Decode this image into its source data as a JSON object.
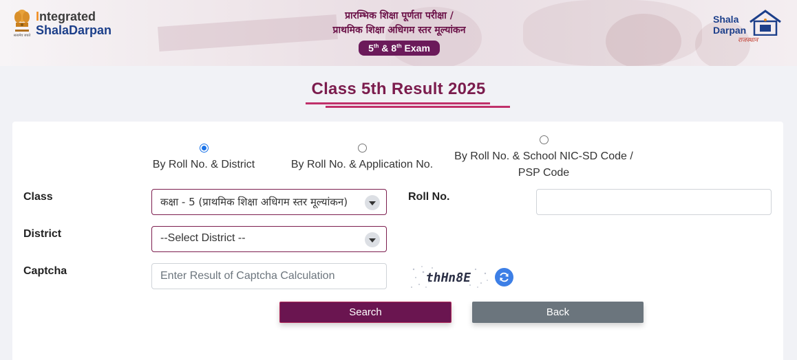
{
  "header": {
    "logo_left": {
      "word1_first": "I",
      "word1_rest": "ntegrated",
      "word2_first": "S",
      "word2_rest": "halaDarpan"
    },
    "title_line1": "प्रारम्भिक शिक्षा पूर्णता परीक्षा /",
    "title_line2": "प्राथमिक शिक्षा अधिगम स्तर मूल्यांकन",
    "exam_pill": {
      "n1": "5",
      "s1": "th",
      "amp": " & ",
      "n2": "8",
      "s2": "th",
      "word": " Exam"
    },
    "logo_right": {
      "line1": "Shala",
      "line2": "Darpan",
      "sub": "राजस्थान"
    }
  },
  "page_title": "Class 5th Result 2025",
  "search_options": [
    {
      "label": "By Roll No. & District",
      "selected": true
    },
    {
      "label": "By Roll No. & Application No.",
      "selected": false
    },
    {
      "label_line1": "By Roll No. & School NIC-SD Code /",
      "label_line2": "PSP Code",
      "selected": false
    }
  ],
  "form": {
    "class_label": "Class",
    "class_value": "कक्षा - 5 (प्राथमिक शिक्षा अधिगम स्तर मूल्यांकन)",
    "roll_label": "Roll No.",
    "roll_value": "",
    "district_label": "District",
    "district_value": "--Select District --",
    "captcha_label": "Captcha",
    "captcha_placeholder": "Enter Result of Captcha Calculation",
    "captcha_text": "thHn8E"
  },
  "buttons": {
    "search": "Search",
    "back": "Back"
  },
  "colors": {
    "brand_maroon": "#7b1c4d",
    "search_button": "#6a1550",
    "back_button": "#6b757d",
    "radio_selected": "#1a73e8",
    "refresh_button": "#3d7fe6"
  },
  "icons": [
    "state-emblem-icon",
    "shaladarpan-house-icon",
    "dropdown-arrow-icon",
    "refresh-icon"
  ]
}
